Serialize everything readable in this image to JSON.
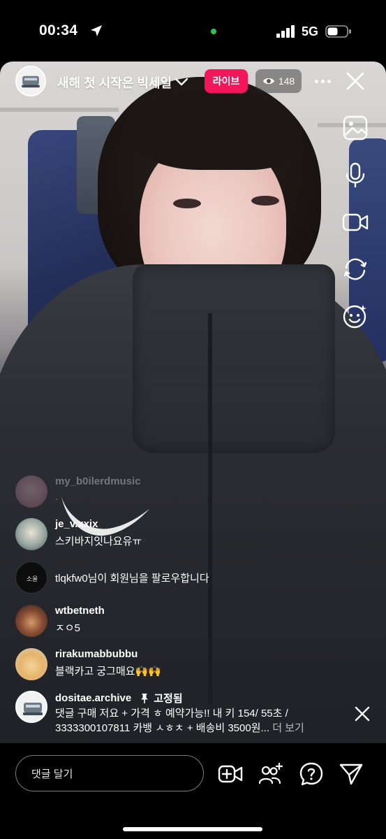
{
  "status_bar": {
    "time": "00:34",
    "network": "5G"
  },
  "header": {
    "title": "새해 첫 시작은 빅세일",
    "live_label": "라이브",
    "viewer_count": "148"
  },
  "comments": [
    {
      "username": "my_b0ilerdmusic",
      "text": ".",
      "faded": true
    },
    {
      "username": "je_v.xxix",
      "text": "스키바지잇나요유ㅠ"
    },
    {
      "username": "",
      "text": "tlqkfw0님이 회원님을 팔로우합니다",
      "system": true
    },
    {
      "username": "wtbetneth",
      "text": "ㅈㅇ5"
    },
    {
      "username": "rirakumabbubbu",
      "text": "블랙카고 궁그매요🙌🙌"
    }
  ],
  "pinned": {
    "username": "dositae.archive",
    "pinned_label": "고정됨",
    "text_line1": "댓글 구매 저요 + 가격 ㅎ 예약가능!! 내 키 154/ 55초 /",
    "text_line2": "3333300107811 카뱅 ㅅㅎㅊ + 배송비 3500원...",
    "more_label": "더 보기"
  },
  "bottom_bar": {
    "comment_placeholder": "댓글 달기"
  },
  "colors": {
    "live_badge": "#f2165b",
    "background": "#000000"
  },
  "icons": {
    "side": [
      "image-icon",
      "microphone-icon",
      "video-camera-icon",
      "flip-camera-icon",
      "face-effects-icon"
    ],
    "bottom": [
      "add-video-icon",
      "add-guest-icon",
      "question-icon",
      "send-icon"
    ]
  }
}
